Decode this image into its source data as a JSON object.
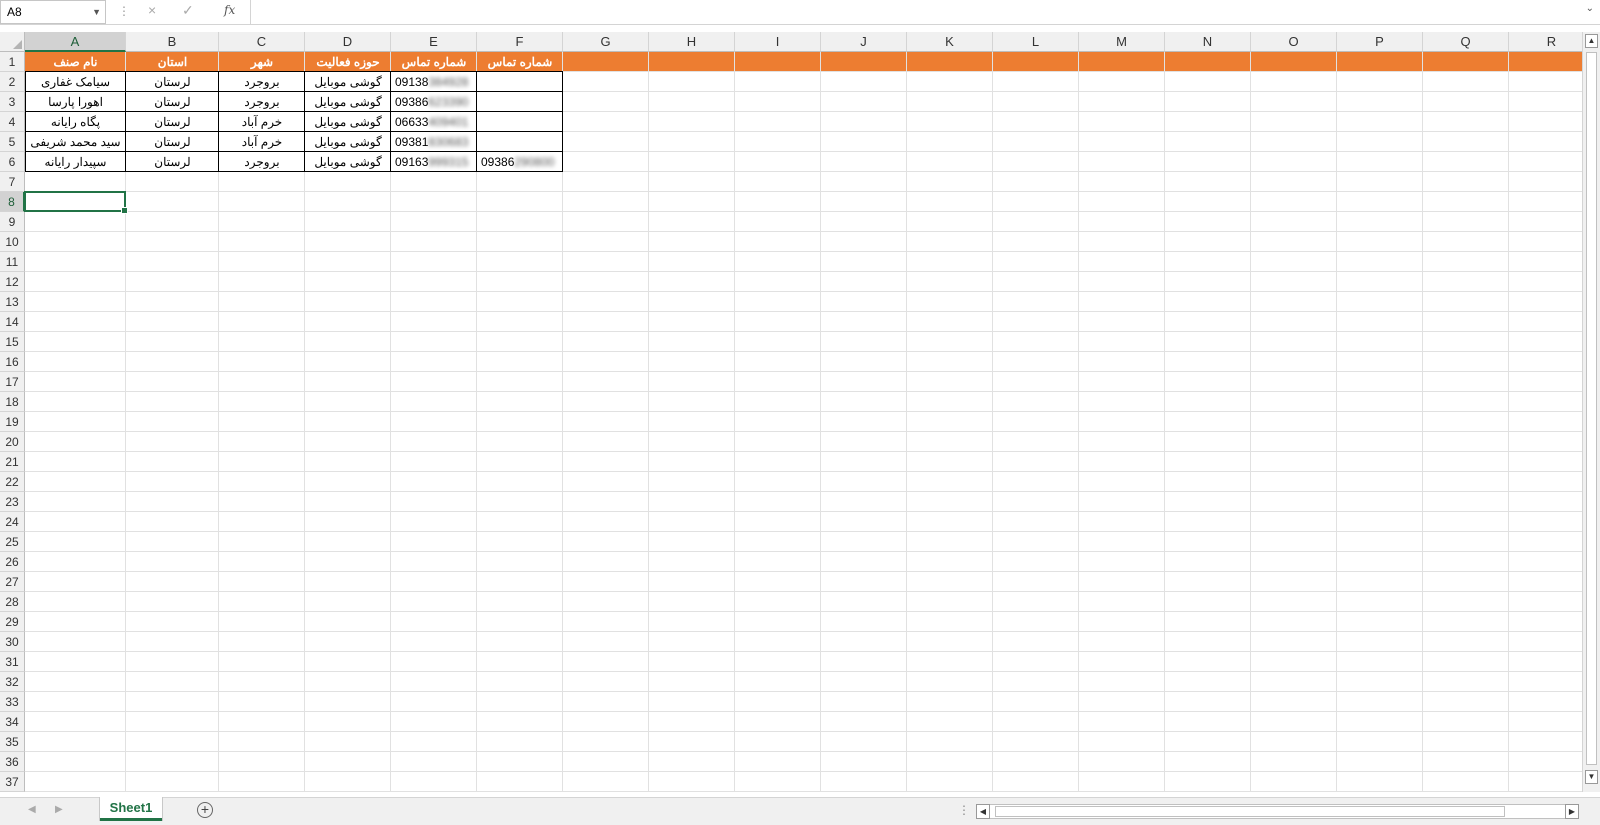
{
  "formula_bar": {
    "name_box": "A8",
    "cancel_icon": "×",
    "enter_icon": "✓",
    "fx_label": "fx",
    "content": ""
  },
  "columns": [
    "A",
    "B",
    "C",
    "D",
    "E",
    "F",
    "G",
    "H",
    "I",
    "J",
    "K",
    "L",
    "M",
    "N",
    "O",
    "P",
    "Q",
    "R"
  ],
  "rows": [
    "1",
    "2",
    "3",
    "4",
    "5",
    "6",
    "7",
    "8",
    "9",
    "10",
    "11",
    "12",
    "13",
    "14",
    "15",
    "16",
    "17",
    "18",
    "19",
    "20",
    "21",
    "22",
    "23",
    "24",
    "25",
    "26",
    "27",
    "28",
    "29",
    "30",
    "31",
    "32",
    "33",
    "34",
    "35",
    "36",
    "37"
  ],
  "selected_cell": {
    "column": "A",
    "row": "8"
  },
  "header_fill_color": "#ed7d31",
  "table": {
    "headers": [
      "نام صنف",
      "استان",
      "شهر",
      "حوزه فعالیت",
      "شماره تماس",
      "شماره تماس"
    ],
    "rows": [
      [
        "سیامک غفاری",
        "لرستان",
        "بروجرد",
        "گوشی موبایل",
        "09138384928",
        ""
      ],
      [
        "اهورا پارسا",
        "لرستان",
        "بروجرد",
        "گوشی موبایل",
        "09386623390",
        ""
      ],
      [
        "پگاه رایانه",
        "لرستان",
        "خرم آباد",
        "گوشی موبایل",
        "06633409401",
        ""
      ],
      [
        "سید محمد شریفی",
        "لرستان",
        "خرم آباد",
        "گوشی موبایل",
        "09381830683",
        ""
      ],
      [
        "سپیدار رایانه",
        "لرستان",
        "بروجرد",
        "گوشی موبایل",
        "09163999315",
        "09386290800"
      ]
    ]
  },
  "sheet_tabs": [
    "Sheet1"
  ],
  "add_sheet_label": "+"
}
